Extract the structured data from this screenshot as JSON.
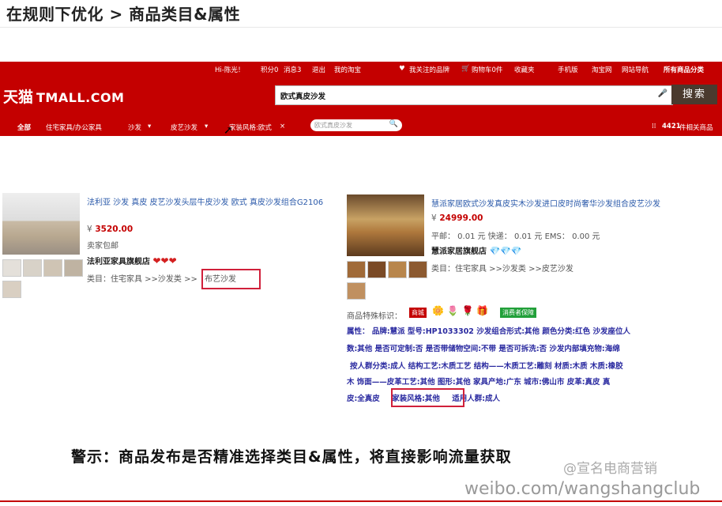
{
  "slide": {
    "title": "在规则下优化 > 商品类目&属性",
    "warning": "警示：商品发布是否精准选择类目&属性，将直接影响流量获取",
    "watermark_handle": "@宣名电商营销",
    "watermark_url": "weibo.com/wangshangclub"
  },
  "topbar": {
    "hi": "Hi-陈光！",
    "points": "积分0",
    "messages": "消息3",
    "logout": "退出",
    "my_taobao": "我的淘宝",
    "fav_brand": "我关注的品牌",
    "cart": "购物车0件",
    "favorites": "收藏夹",
    "mobile": "手机版",
    "taobao": "淘宝网",
    "site_nav": "网站导航",
    "all_categories": "所有商品分类"
  },
  "logo": {
    "cn": "天猫",
    "en": "TMALL.COM"
  },
  "search": {
    "value": "欧式真皮沙发",
    "button": "搜索"
  },
  "nav": {
    "all": "全部",
    "cat1": "住宅家具/办公家具",
    "cat2": "沙发",
    "cat3": "皮艺沙发",
    "filter": "家装风格:欧式",
    "filter_close": "×",
    "search_placeholder": "欧式真皮沙发",
    "count": "4421",
    "count_suffix": "件相关商品"
  },
  "product1": {
    "title": "法利亚 沙发 真皮 皮艺沙发头层牛皮沙发 欧式 真皮沙发组合G2106",
    "currency": "¥",
    "price": "3520.00",
    "shipping": "卖家包邮",
    "shop": "法利亚家具旗舰店",
    "hearts": "❤❤❤",
    "category_prefix": "类目：",
    "category_path": "住宅家具 >>沙发类 >>",
    "category_last": "布艺沙发"
  },
  "product2": {
    "title": "慧派家居欧式沙发真皮实木沙发进口皮时尚奢华沙发组合皮艺沙发",
    "currency": "¥",
    "price": "24999.00",
    "shipping": "平邮： 0.01 元 快递： 0.01 元 EMS： 0.00 元",
    "shop": "慧派家居旗舰店",
    "diamonds": "💎💎💎",
    "category_prefix": "类目：",
    "category_path": "住宅家具 >>沙发类 >>皮艺沙发",
    "special_label": "商品特殊标识：",
    "badge1": "商城",
    "badge2": "消费者保障",
    "attr_label": "属性：",
    "attr_line1": "品牌:慧派    型号:HP1033302    沙发组合形式:其他    颜色分类:红色    沙发座位人",
    "attr_line2": "数:其他    是否可定制:否    是否带储物空间:不带    是否可拆洗:否    沙发内部填充物:海绵",
    "attr_line3": "按人群分类:成人    结构工艺:木质工艺    结构——木质工艺:雕刻    材质:木质    木质:橡胶",
    "attr_line4": "木    饰面——皮革工艺:其他    图形:其他    家具产地:广东    城市:佛山市    皮革:真皮    真",
    "attr_line5a": "皮:全真皮",
    "attr_line5b": "家装风格:其他",
    "attr_line5c": "适用人群:成人"
  },
  "colors": {
    "tmall_red": "#c40000",
    "link_blue": "#2b5aaa",
    "highlight_box": "#d0203a"
  }
}
